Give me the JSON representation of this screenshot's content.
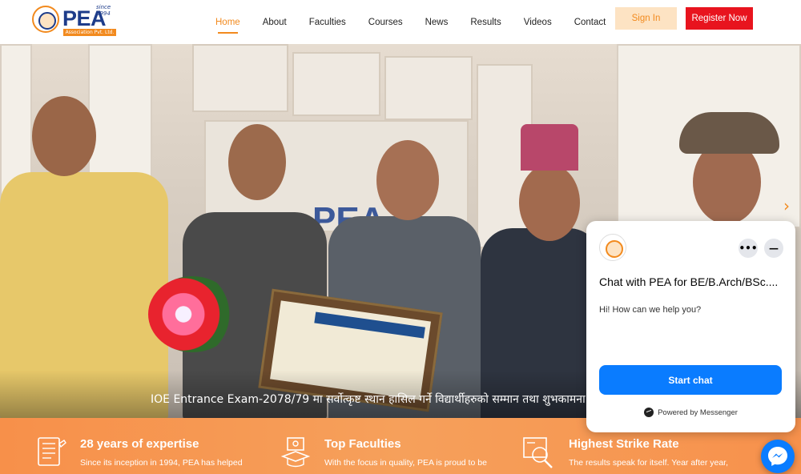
{
  "brand": {
    "since": "since 1994",
    "name": "PEA",
    "subtitle": "Association Pvt. Ltd."
  },
  "nav": {
    "items": [
      "Home",
      "About",
      "Faculties",
      "Courses",
      "News",
      "Results",
      "Videos",
      "Contact"
    ],
    "active": "Home"
  },
  "auth": {
    "signin_label": "Sign In",
    "register_label": "Register Now"
  },
  "hero": {
    "caption": "IOE Entrance Exam-2078/79 मा सर्वोत्कृष्ट स्थान हासिल गर्ने विद्यार्थीहरुको सम्मान तथा शुभकामना",
    "sign_text": "PEA"
  },
  "features": [
    {
      "icon": "document-list-icon",
      "title": "28 years of expertise",
      "desc": "Since its inception in 1994, PEA has helped"
    },
    {
      "icon": "teacher-board-icon",
      "title": "Top Faculties",
      "desc": "With the focus in quality, PEA is proud to be"
    },
    {
      "icon": "search-target-icon",
      "title": "Highest Strike Rate",
      "desc": "The results speak for itself. Year after year,"
    }
  ],
  "chat": {
    "title": "Chat with PEA for BE/B.Arch/BSc....",
    "greeting": "Hi! How can we help you?",
    "start_label": "Start chat",
    "powered_by": "Powered by Messenger"
  },
  "colors": {
    "accent": "#f28a1e",
    "brand_blue": "#1d3c8a",
    "register_red": "#e8141e",
    "messenger_blue": "#0a7cff"
  }
}
